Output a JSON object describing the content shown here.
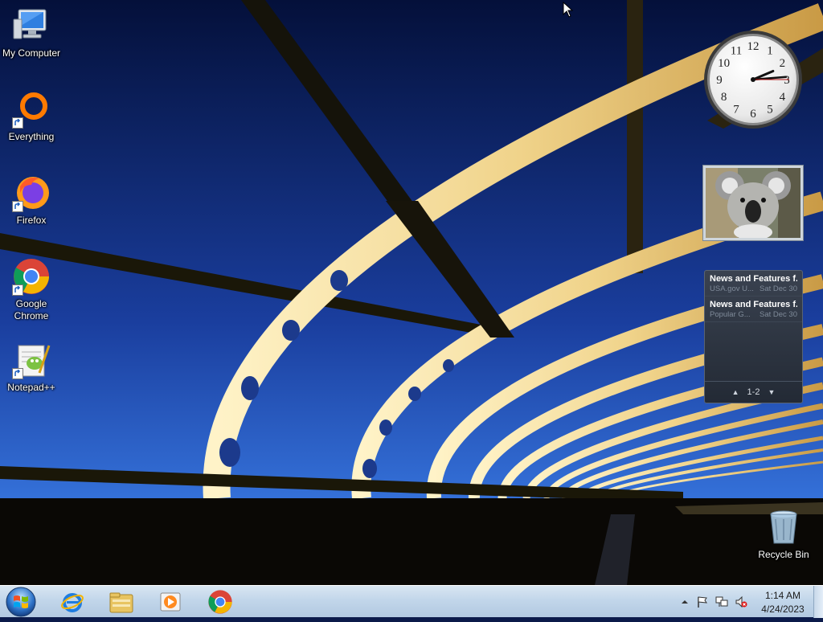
{
  "desktop": {
    "icons": [
      {
        "label": "My Computer",
        "icon": "computer-icon"
      },
      {
        "label": "Everything",
        "icon": "everything-icon"
      },
      {
        "label": "Firefox",
        "icon": "firefox-icon"
      },
      {
        "label": "Google Chrome",
        "icon": "chrome-icon"
      },
      {
        "label": "Notepad++",
        "icon": "notepad-plus-plus-icon"
      },
      {
        "label": "Recycle Bin",
        "icon": "recycle-bin-icon"
      }
    ]
  },
  "gadgets": {
    "clock": {
      "hour": 2,
      "minute": 14,
      "second": 15,
      "numerals": [
        "12",
        "1",
        "2",
        "3",
        "4",
        "5",
        "6",
        "7",
        "8",
        "9",
        "10",
        "11"
      ]
    },
    "feed": {
      "items": [
        {
          "title": "News and Features f...",
          "source": "USA.gov U...",
          "date": "Sat Dec 30"
        },
        {
          "title": "News and Features f...",
          "source": "Popular G...",
          "date": "Sat Dec 30"
        }
      ],
      "page": "1-2"
    }
  },
  "taskbar": {
    "pinned": [
      "internet-explorer-icon",
      "windows-explorer-icon",
      "media-player-icon",
      "chrome-icon"
    ],
    "tray": {
      "time": "1:14 AM",
      "date": "4/24/2023"
    }
  },
  "colors": {
    "sky_top": "#05123a",
    "sky_bottom": "#2a5fd0",
    "bridge": "#f2d98a"
  }
}
